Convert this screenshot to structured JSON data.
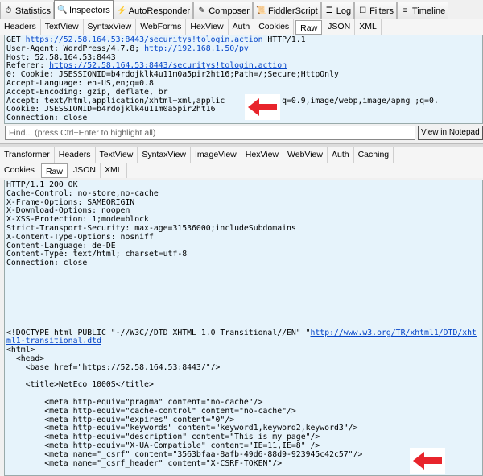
{
  "main_tabs": [
    {
      "label": "Statistics",
      "icon": "stopwatch-icon"
    },
    {
      "label": "Inspectors",
      "icon": "magnifier-icon",
      "active": true
    },
    {
      "label": "AutoResponder",
      "icon": "lightning-icon"
    },
    {
      "label": "Composer",
      "icon": "pencil-icon"
    },
    {
      "label": "FiddlerScript",
      "icon": "script-icon"
    },
    {
      "label": "Log",
      "icon": "log-icon"
    },
    {
      "label": "Filters",
      "icon": "checkbox-icon"
    },
    {
      "label": "Timeline",
      "icon": "timeline-icon"
    }
  ],
  "request": {
    "tabs": [
      "Headers",
      "TextView",
      "SyntaxView",
      "WebForms",
      "HexView",
      "Auth",
      "Cookies",
      "Raw",
      "JSON",
      "XML"
    ],
    "active_tab": "Raw",
    "lines": [
      {
        "pre": "GET ",
        "link": "https://52.58.164.53:8443/securitys!tologin.action",
        "post": " HTTP/1.1"
      },
      {
        "pre": "User-Agent: WordPress/4.7.8; ",
        "link": "http://192.168.1.50/pv",
        "post": ""
      },
      {
        "pre": "Host: 52.58.164.53:8443"
      },
      {
        "pre": "Referer: ",
        "link": "https://52.58.164.53:8443/securitys!tologin.action",
        "post": ""
      },
      {
        "pre": "0: Cookie: JSESSIONID=b4rdojklk4u11m0a5pir2ht16;Path=/;Secure;HttpOnly"
      },
      {
        "pre": "Accept-Language: en-US,en;q=0.8"
      },
      {
        "pre": "Accept-Encoding: gzip, deflate, br"
      },
      {
        "pre": "Accept: text/html,application/xhtml+xml,applic         ml;q=0.9,image/webp,image/apng ;q=0."
      },
      {
        "pre": "Cookie: JSESSIONID=b4rdojklk4u11m0a5pir2ht16"
      },
      {
        "pre": "Connection: close"
      }
    ],
    "find_placeholder": "Find... (press Ctrl+Enter to highlight all)",
    "view_notepad": "View in Notepad"
  },
  "response": {
    "tabs_row1": [
      "Transformer",
      "Headers",
      "TextView",
      "SyntaxView",
      "ImageView",
      "HexView",
      "WebView",
      "Auth",
      "Caching"
    ],
    "tabs_row2": [
      "Cookies",
      "Raw",
      "JSON",
      "XML"
    ],
    "active_tab": "Raw",
    "headers": "HTTP/1.1 200 OK\nCache-Control: no-store,no-cache\nX-Frame-Options: SAMEORIGIN\nX-Download-Options: noopen\nX-XSS-Protection: 1;mode=block\nStrict-Transport-Security: max-age=31536000;includeSubdomains\nX-Content-Type-Options: nosniff\nContent-Language: de-DE\nContent-Type: text/html; charset=utf-8\nConnection: close",
    "doctype_pre": "<!DOCTYPE html PUBLIC \"-//W3C//DTD XHTML 1.0 Transitional//EN\" \"",
    "doctype_link": "http://www.w3.org/TR/xhtml1/DTD/xhtml1-transitional.dtd",
    "body": "<html>\n  <head>\n    <base href=\"https://52.58.164.53:8443/\"/>\n\n    <title>NetEco 1000S</title>\n\n        <meta http-equiv=\"pragma\" content=\"no-cache\"/>\n        <meta http-equiv=\"cache-control\" content=\"no-cache\"/>\n        <meta http-equiv=\"expires\" content=\"0\"/>\n        <meta http-equiv=\"keywords\" content=\"keyword1,keyword2,keyword3\"/>\n        <meta http-equiv=\"description\" content=\"This is my page\"/>\n        <meta http-equiv=\"X-UA-Compatible\" content=\"IE=11,IE=8\" />\n        <meta name=\"_csrf\" content=\"3563bfaa-8afb-49d6-88d9-923945c42c57\"/>\n        <meta name=\"_csrf_header\" content=\"X-CSRF-TOKEN\"/>"
  },
  "colors": {
    "text_bg": "#e6f3fb",
    "link": "#0645c8",
    "arrow": "#e8242b"
  }
}
